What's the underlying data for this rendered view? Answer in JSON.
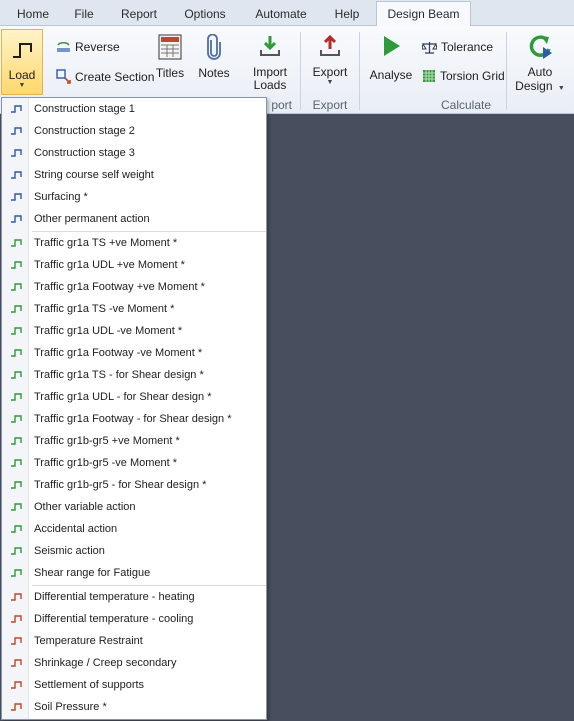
{
  "tabs": [
    "Home",
    "File",
    "Report",
    "Options",
    "Automate",
    "Help",
    "Design Beam"
  ],
  "ribbon": {
    "load": "Load",
    "reverse": "Reverse",
    "create_section": "Create Section",
    "titles": "Titles",
    "notes": "Notes",
    "import_loads_1": "Import",
    "import_loads_2": "Loads",
    "import_group": "port",
    "export": "Export",
    "export_group": "Export",
    "analyse": "Analyse",
    "tolerance": "Tolerance",
    "torsion_grid": "Torsion Grid",
    "auto_design_1": "Auto",
    "auto_design_2": "Design",
    "calculate_group": "Calculate"
  },
  "colors": {
    "icon_blue": "#2e5aa8",
    "icon_green": "#2f9a3a",
    "icon_red": "#b84a2b",
    "canvas": "#474f5e"
  },
  "menu": {
    "permanent": [
      "Construction stage 1",
      "Construction stage 2",
      "Construction stage 3",
      "String course self weight",
      "Surfacing *",
      "Other permanent action"
    ],
    "variable": [
      "Traffic gr1a TS +ve Moment *",
      "Traffic gr1a UDL +ve Moment *",
      "Traffic gr1a Footway +ve Moment *",
      "Traffic gr1a TS -ve Moment *",
      "Traffic gr1a UDL -ve Moment *",
      "Traffic gr1a Footway -ve Moment *",
      "Traffic gr1a TS - for Shear design *",
      "Traffic gr1a UDL - for Shear design *",
      "Traffic gr1a Footway - for Shear design *",
      "Traffic gr1b-gr5 +ve Moment *",
      "Traffic gr1b-gr5 -ve Moment *",
      "Traffic gr1b-gr5 - for Shear design *",
      "Other variable action",
      "Accidental action",
      "Seismic action",
      "Shear range for Fatigue"
    ],
    "other": [
      "Differential temperature - heating",
      "Differential temperature - cooling",
      "Temperature Restraint",
      "Shrinkage / Creep secondary",
      "Settlement of supports",
      "Soil Pressure *"
    ]
  }
}
